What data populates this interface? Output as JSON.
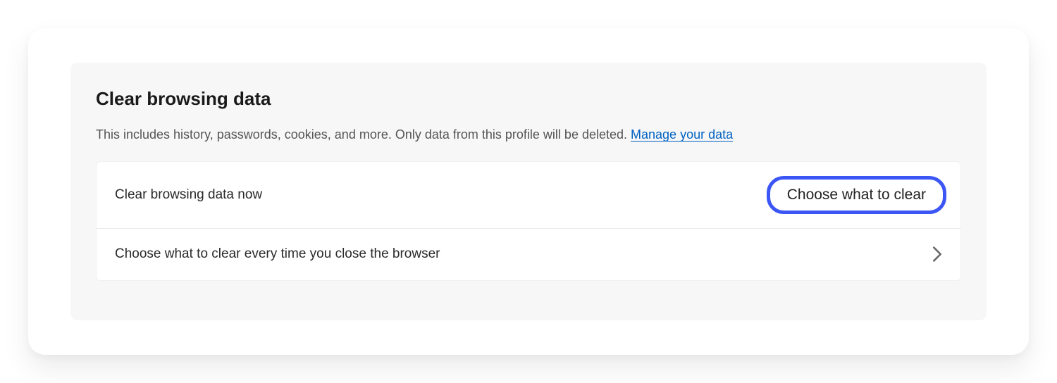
{
  "section": {
    "title": "Clear browsing data",
    "description_prefix": "This includes history, passwords, cookies, and more. Only data from this profile will be deleted. ",
    "manage_link": "Manage your data"
  },
  "rows": {
    "clear_now": {
      "label": "Clear browsing data now",
      "button": "Choose what to clear"
    },
    "clear_on_close": {
      "label": "Choose what to clear every time you close the browser"
    }
  }
}
